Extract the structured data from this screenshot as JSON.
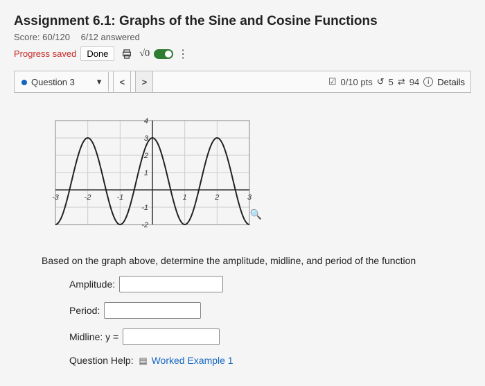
{
  "header": {
    "title": "Assignment 6.1: Graphs of the Sine and Cosine Functions",
    "score_label": "Score: 60/120",
    "answered_label": "6/12 answered",
    "progress_saved": "Progress saved",
    "done_label": "Done",
    "sqrt_label": "√0"
  },
  "qbar": {
    "question_label": "Question 3",
    "pts_label": "0/10 pts",
    "retries": "5",
    "attempts": "94",
    "details_label": "Details"
  },
  "chart_data": {
    "type": "line",
    "title": "",
    "xlabel": "",
    "ylabel": "",
    "xlim": [
      -3,
      3
    ],
    "ylim": [
      -2,
      4
    ],
    "x_ticks": [
      -3,
      -2,
      -1,
      1,
      2,
      3
    ],
    "y_ticks": [
      -2,
      -1,
      1,
      2,
      3,
      4
    ],
    "function": "y = 2.5*cos(pi*x) + 0.5",
    "amplitude": 2.5,
    "midline": 0.5,
    "period": 2,
    "series": [
      {
        "name": "curve",
        "points": [
          {
            "x": -3.0,
            "y": -2.0
          },
          {
            "x": -2.5,
            "y": 0.5
          },
          {
            "x": -2.0,
            "y": 3.0
          },
          {
            "x": -1.5,
            "y": 0.5
          },
          {
            "x": -1.0,
            "y": -2.0
          },
          {
            "x": -0.5,
            "y": 0.5
          },
          {
            "x": 0.0,
            "y": 3.0
          },
          {
            "x": 0.5,
            "y": 0.5
          },
          {
            "x": 1.0,
            "y": -2.0
          },
          {
            "x": 1.5,
            "y": 0.5
          },
          {
            "x": 2.0,
            "y": 3.0
          },
          {
            "x": 2.5,
            "y": 0.5
          },
          {
            "x": 3.0,
            "y": -2.0
          }
        ]
      }
    ]
  },
  "content": {
    "prompt": "Based on the graph above, determine the amplitude, midline, and period of the function",
    "amplitude_label": "Amplitude:",
    "period_label": "Period:",
    "midline_label": "Midline: y =",
    "help_label": "Question Help:",
    "worked_example": "Worked Example 1"
  }
}
